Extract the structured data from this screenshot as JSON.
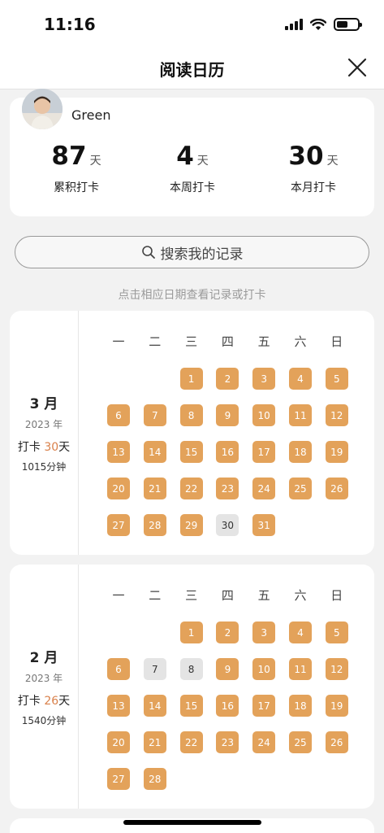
{
  "status_bar": {
    "time": "11:16"
  },
  "nav": {
    "title": "阅读日历"
  },
  "profile": {
    "username": "Green"
  },
  "stats": [
    {
      "value": "87",
      "unit": "天",
      "label": "累积打卡"
    },
    {
      "value": "4",
      "unit": "天",
      "label": "本周打卡"
    },
    {
      "value": "30",
      "unit": "天",
      "label": "本月打卡"
    }
  ],
  "search": {
    "placeholder": "搜索我的记录"
  },
  "hint": "点击相应日期查看记录或打卡",
  "weekday_labels": [
    "一",
    "二",
    "三",
    "四",
    "五",
    "六",
    "日"
  ],
  "months": [
    {
      "name": "3 月",
      "year": "2023 年",
      "checkin_prefix": "打卡 ",
      "checkin_days": "30",
      "checkin_suffix": "天",
      "minutes": "1015分钟",
      "first_weekday": 3,
      "days_in_month": 31,
      "unchecked_days": [
        30
      ]
    },
    {
      "name": "2 月",
      "year": "2023 年",
      "checkin_prefix": "打卡 ",
      "checkin_days": "26",
      "checkin_suffix": "天",
      "minutes": "1540分钟",
      "first_weekday": 3,
      "days_in_month": 28,
      "unchecked_days": [
        7,
        8
      ]
    }
  ],
  "colors": {
    "checked": "#e3a25a",
    "unchecked": "#e4e4e4",
    "highlight": "#d9804a"
  }
}
